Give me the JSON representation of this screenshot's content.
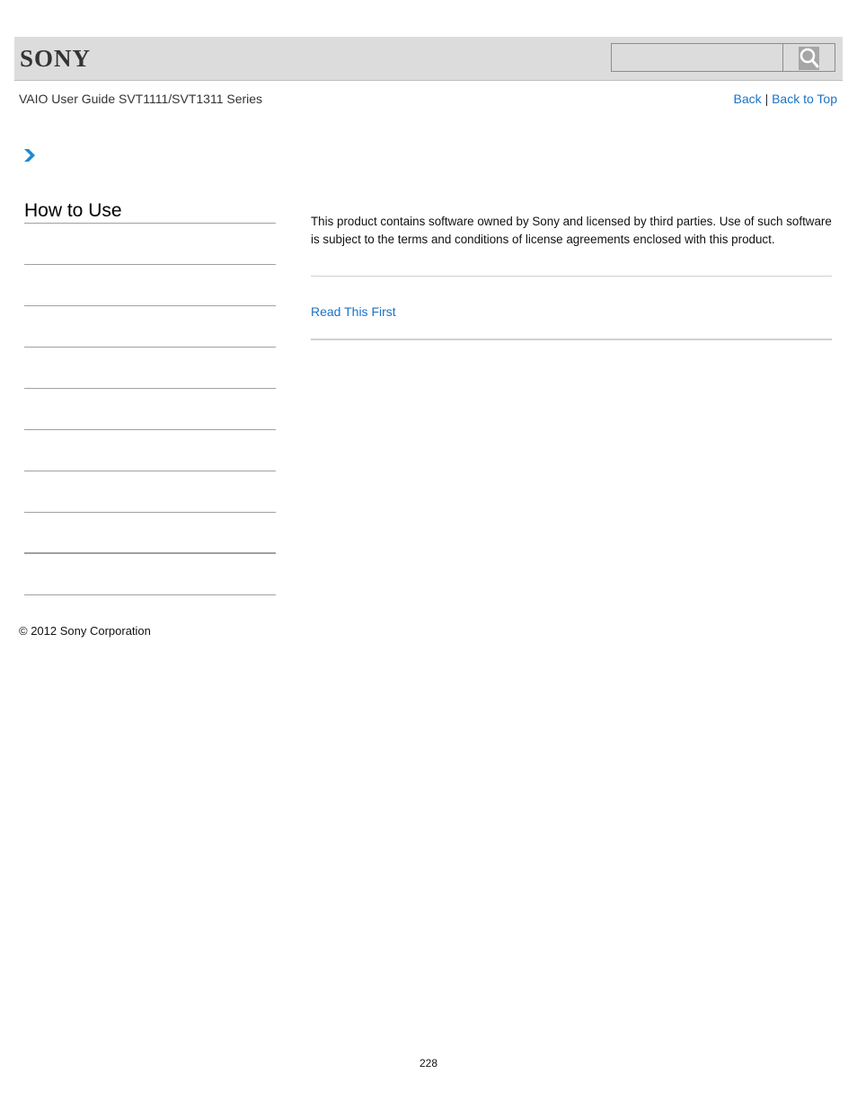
{
  "header": {
    "logo": "SONY",
    "search": {
      "value": "",
      "placeholder": ""
    },
    "search_button_icon": "magnifier-icon"
  },
  "subheader": {
    "guide_title": "VAIO User Guide SVT1111/SVT1311 Series",
    "links": {
      "back": "Back",
      "separator": "|",
      "back_to_top": "Back to Top"
    }
  },
  "breadcrumb": {
    "icon": "chevron-right-icon",
    "color": "#1e88d2"
  },
  "sidebar": {
    "title": "How to Use",
    "items": [
      {
        "label": ""
      },
      {
        "label": ""
      },
      {
        "label": ""
      },
      {
        "label": ""
      },
      {
        "label": ""
      },
      {
        "label": ""
      },
      {
        "label": ""
      },
      {
        "label": ""
      },
      {
        "label": ""
      }
    ]
  },
  "main": {
    "body_text": "This product contains software owned by Sony and licensed by third parties. Use of such software is subject to the terms and conditions of license agreements enclosed with this product.",
    "related_link": "Read This First"
  },
  "footer": {
    "copyright": "© 2012 Sony Corporation",
    "page_number": "228"
  },
  "colors": {
    "link": "#1a73c5",
    "header_bg": "#dcdcdc",
    "divider": "#a0a0a0"
  }
}
